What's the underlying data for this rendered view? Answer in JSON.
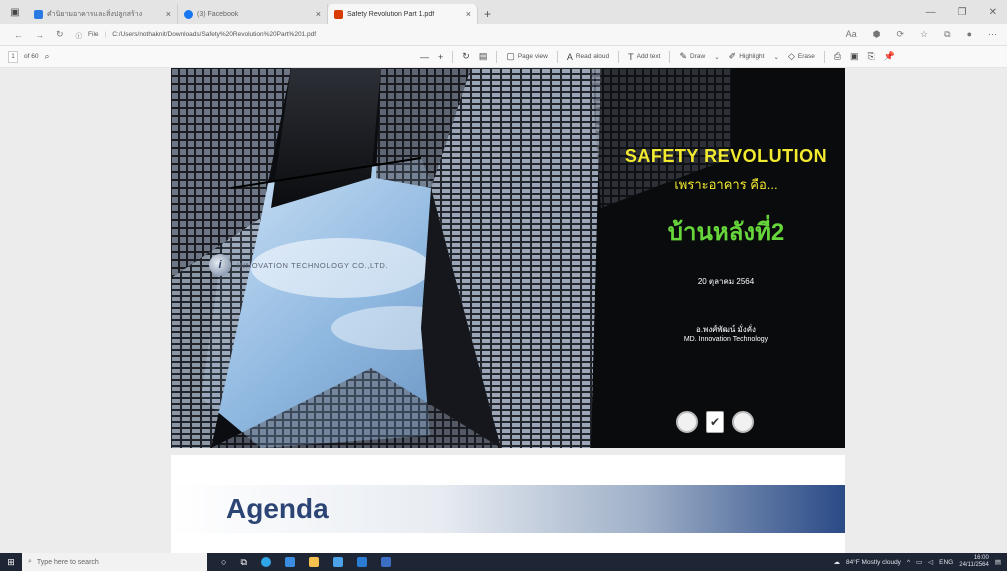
{
  "browser": {
    "tabs": [
      {
        "title": "คำนิยามอาคารและสิ่งปลูกสร้าง",
        "active": false,
        "favicon_color": "#2a7ae2"
      },
      {
        "title": "(3) Facebook",
        "active": false,
        "favicon_color": "#1877f2"
      },
      {
        "title": "Safety Revolution Part 1.pdf",
        "active": true,
        "favicon_color": "#d83b01"
      }
    ],
    "new_tab_symbol": "+",
    "file_label": "File",
    "url": "C:/Users/nothaknit/Downloads/Safety%20Revolution%20Part%201.pdf"
  },
  "pdf_toolbar": {
    "page_number": "1",
    "search_text": "of 60",
    "zoom_out": "—",
    "zoom_in": "+",
    "page_view": "Page view",
    "read_aloud": "Read aloud",
    "add_text": "Add text",
    "draw": "Draw",
    "highlight": "Highlight",
    "erase": "Erase"
  },
  "slide": {
    "title": "SAFETY REVOLUTION",
    "subtitle": "เพราะอาคาร คือ...",
    "headline": "บ้านหลังที่2",
    "date": "20 ตุลาคม 2564",
    "presenter": "อ.พงศ์พัฒน์ มั่งคั่ง",
    "role": "MD. Innovation Technology",
    "logo_text": "INNOVATION TECHNOLOGY CO.,LTD.",
    "logo_mark": "i"
  },
  "page2": {
    "heading": "Agenda"
  },
  "taskbar": {
    "search_placeholder": "Type here to search",
    "weather": "84°F Mostly cloudy",
    "lang": "ENG",
    "time": "16:00",
    "date": "24/11/2564"
  }
}
